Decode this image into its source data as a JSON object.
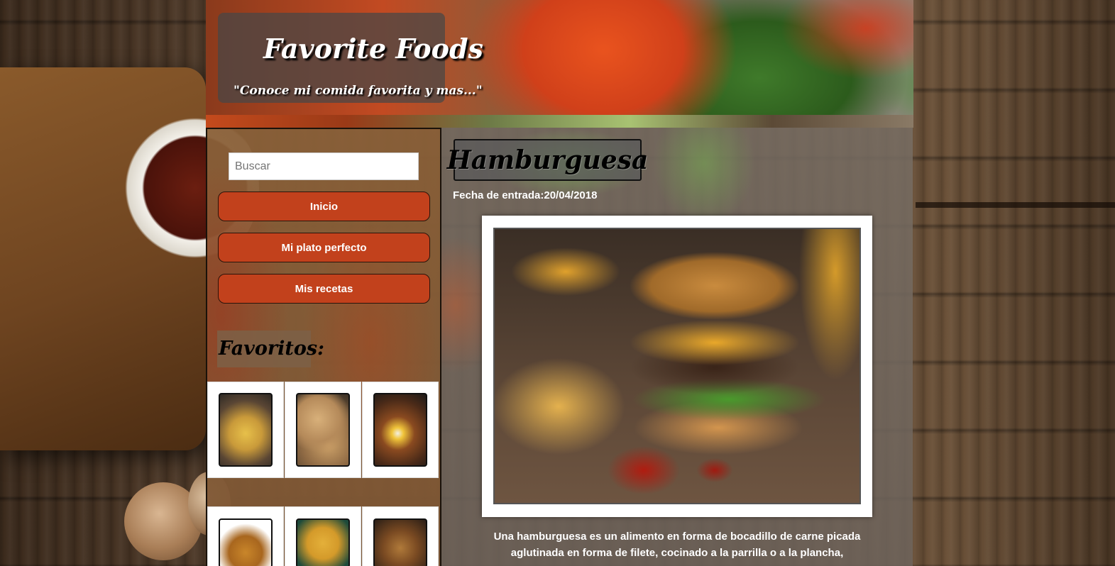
{
  "header": {
    "title": "Favorite Foods",
    "subtitle": "\"Conoce mi comida favorita y mas...\""
  },
  "sidebar": {
    "search_placeholder": "Buscar",
    "nav": [
      {
        "label": "Inicio"
      },
      {
        "label": "Mi plato perfecto"
      },
      {
        "label": "Mis recetas"
      }
    ],
    "favorites_title": "Favoritos:",
    "favorites": [
      {
        "icon": "soup-dish-thumbnail",
        "color": "#c99a3a"
      },
      {
        "icon": "arepas-thumbnail",
        "color": "#b58a5a"
      },
      {
        "icon": "bandeja-paisa-thumbnail",
        "color": "#8a4a20"
      },
      {
        "icon": "roast-chicken-thumbnail",
        "color": "#c9862a"
      },
      {
        "icon": "fried-snacks-thumbnail",
        "color": "#d49a2a"
      },
      {
        "icon": "steak-dish-thumbnail",
        "color": "#7a4a22"
      }
    ]
  },
  "article": {
    "title": "Hamburguesa",
    "entry_date": "Fecha de entrada:20/04/2018",
    "image_icon": "hamburger-photo",
    "description": "Una hamburguesa es un alimento en forma de bocadillo de carne picada aglutinada en forma de filete, cocinado a la parrilla o a la plancha,"
  },
  "colors": {
    "button": "#c2411c",
    "accent_dark": "#1a120a"
  }
}
